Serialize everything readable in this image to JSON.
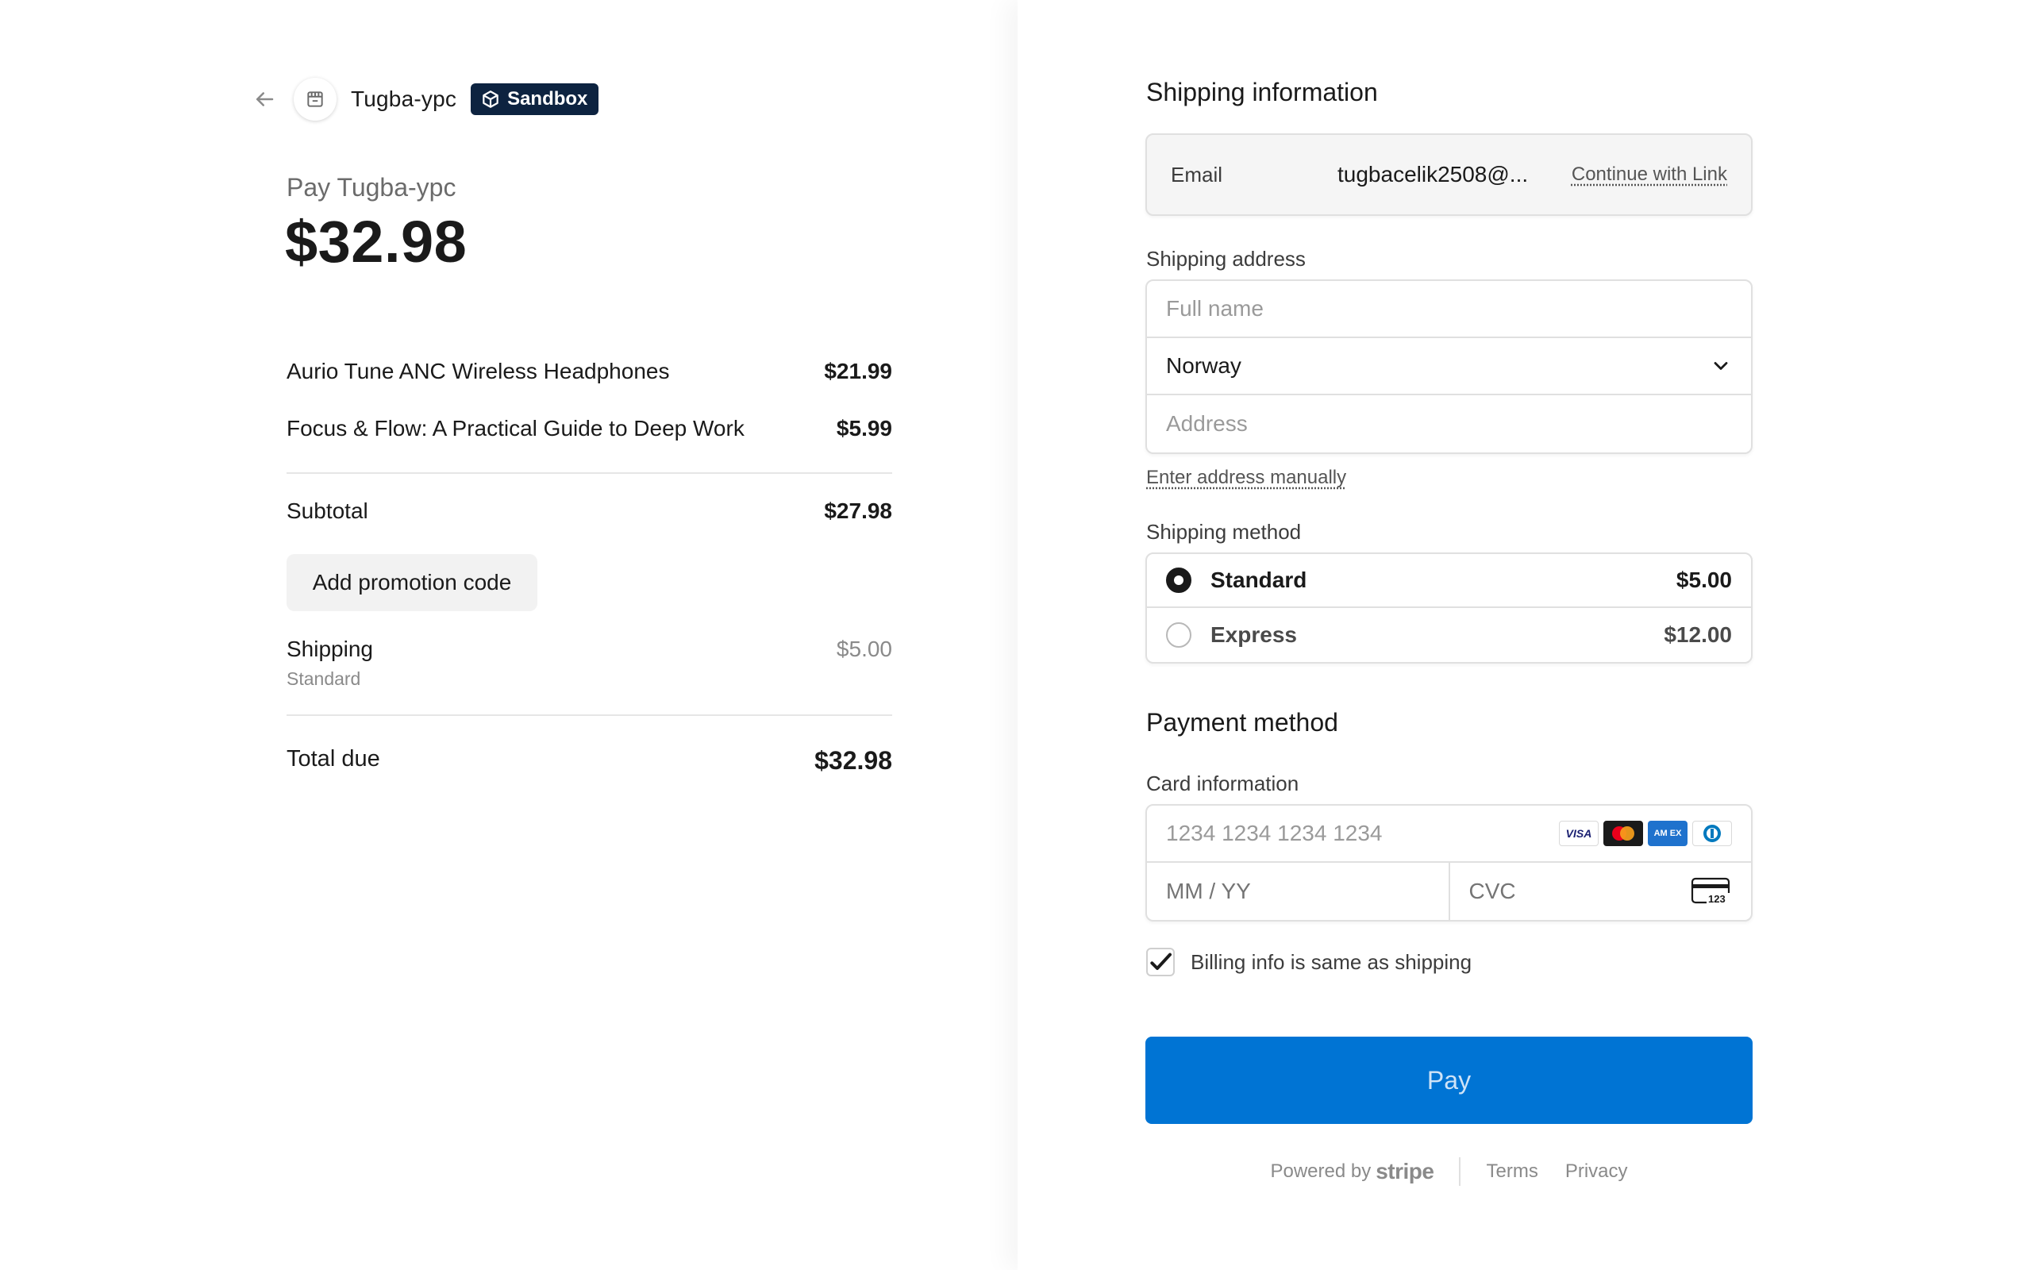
{
  "merchant": {
    "name": "Tugba-ypc",
    "badge": "Sandbox",
    "icon": "store-icon"
  },
  "summary": {
    "pay_label": "Pay Tugba-ypc",
    "total_amount": "$32.98",
    "items": [
      {
        "name": "Aurio Tune ANC Wireless Headphones",
        "price": "$21.99"
      },
      {
        "name": "Focus & Flow: A Practical Guide to Deep Work",
        "price": "$5.99"
      }
    ],
    "subtotal_label": "Subtotal",
    "subtotal": "$27.98",
    "promo_label": "Add promotion code",
    "shipping_label": "Shipping",
    "shipping_method": "Standard",
    "shipping_amount": "$5.00",
    "total_label": "Total due",
    "total_due": "$32.98"
  },
  "shipping_info": {
    "title": "Shipping information",
    "email_label": "Email",
    "email_value": "tugbacelik2508@...",
    "link_label": "Continue with Link",
    "address_label": "Shipping address",
    "full_name_placeholder": "Full name",
    "country": "Norway",
    "address_placeholder": "Address",
    "manual_link": "Enter address manually"
  },
  "shipping_method": {
    "label": "Shipping method",
    "options": [
      {
        "name": "Standard",
        "price": "$5.00",
        "selected": true
      },
      {
        "name": "Express",
        "price": "$12.00",
        "selected": false
      }
    ]
  },
  "payment": {
    "title": "Payment method",
    "card_label": "Card information",
    "card_placeholder": "1234 1234 1234 1234",
    "card_brands": [
      "VISA",
      "mastercard",
      "amex",
      "diners"
    ],
    "expiry_placeholder": "MM / YY",
    "cvc_placeholder": "CVC",
    "cvc_icon_text": "123",
    "billing_same_label": "Billing info is same as shipping",
    "billing_same_checked": true,
    "pay_label": "Pay"
  },
  "footer": {
    "powered_by": "Powered by",
    "brand": "stripe",
    "terms": "Terms",
    "privacy": "Privacy"
  },
  "colors": {
    "pay_button": "#0074d4",
    "sandbox_badge": "#0d2340"
  }
}
